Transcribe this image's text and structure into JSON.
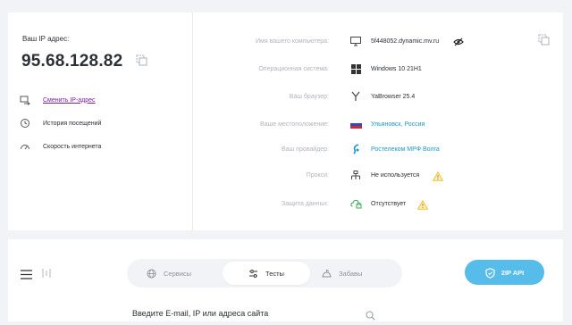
{
  "ip_block": {
    "label": "Ваш IP адрес:",
    "value": "95.68.128.82"
  },
  "left_links": [
    {
      "label": "Сменить IP-адрес",
      "icon": "swap-icon"
    },
    {
      "label": "История посещений",
      "icon": "history-icon"
    },
    {
      "label": "Скорость интернета",
      "icon": "speedometer-icon"
    }
  ],
  "info_rows": [
    {
      "label": "Имя вашего компьютера:",
      "value": "5f448052.dynamic.mv.ru",
      "icon": "monitor-icon",
      "extra": "hide-eye-icon"
    },
    {
      "label": "Операционная система:",
      "value": "Windows 10 21H1",
      "icon": "windows-icon"
    },
    {
      "label": "Ваш браузер:",
      "value": "YaBrowser 25.4",
      "icon": "yandex-browser-icon"
    },
    {
      "label": "Ваше местоположение:",
      "value": "Ульяновск, Россия",
      "icon": "russia-flag-icon"
    },
    {
      "label": "Ваш провайдер:",
      "value": "Ростелеком МРФ Волга",
      "icon": "rostelecom-icon"
    },
    {
      "label": "Прокси:",
      "value": "Не используется",
      "icon": "proxy-icon",
      "extra": "warning-icon"
    },
    {
      "label": "Защита данных:",
      "value": "Отсутствует",
      "icon": "cloud-lock-icon",
      "extra": "warning-icon"
    }
  ],
  "tabs": [
    {
      "label": "Сервисы",
      "icon": "globe-icon"
    },
    {
      "label": "Тесты",
      "icon": "sliders-icon"
    },
    {
      "label": "Забавы",
      "icon": "fun-icon"
    }
  ],
  "api_button": {
    "label": "2IP API",
    "icon": "shield-icon"
  },
  "search": {
    "label": "Введите E-mail, IP или адреса сайта"
  },
  "colors": {
    "background": "#f1f3f6",
    "card": "#ffffff",
    "accent_link": "#1c97c8",
    "change_ip_link": "#7a1f9b",
    "api_button": "#56bdea",
    "warning": "#f2c230",
    "muted_label": "#b0b4bd"
  }
}
